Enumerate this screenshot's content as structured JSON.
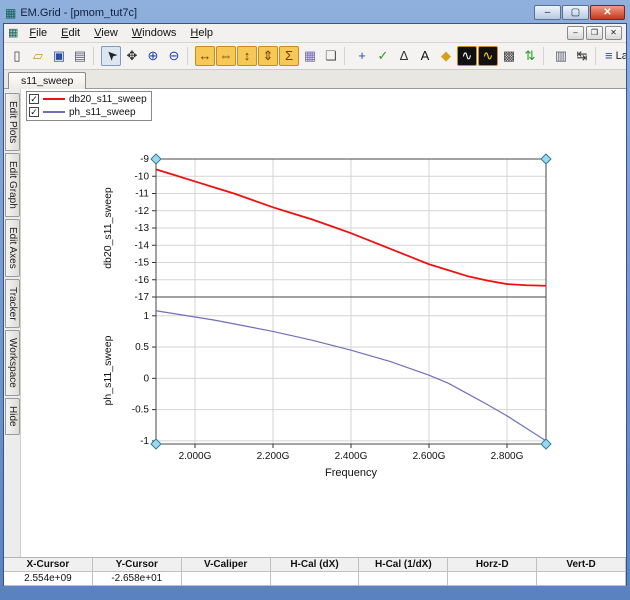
{
  "window": {
    "title": "EM.Grid - [pmom_tut7c]",
    "controls": {
      "minimize": "–",
      "maximize": "▢",
      "close": "✕"
    }
  },
  "menu": {
    "items": [
      "File",
      "Edit",
      "View",
      "Windows",
      "Help"
    ],
    "mdi_controls": {
      "minimize": "–",
      "restore": "❐",
      "close": "✕"
    }
  },
  "toolbar": {
    "icons": [
      {
        "name": "new-document",
        "glyph": "▯",
        "fg": "#444444"
      },
      {
        "name": "open-folder",
        "glyph": "▱",
        "fg": "#c8922a"
      },
      {
        "name": "save",
        "glyph": "▣",
        "fg": "#2a4fa0"
      },
      {
        "name": "print",
        "glyph": "▤",
        "fg": "#556070"
      },
      {
        "sep": true
      },
      {
        "name": "select-cursor",
        "glyph": "➤",
        "fg": "#222222",
        "rotate": -135,
        "pressed": true
      },
      {
        "name": "pan-hand",
        "glyph": "✥",
        "fg": "#333333"
      },
      {
        "name": "zoom-in",
        "glyph": "⊕",
        "fg": "#1a3fb0"
      },
      {
        "name": "zoom-out",
        "glyph": "⊖",
        "fg": "#1a3fb0"
      },
      {
        "sep": true
      },
      {
        "name": "fit-horizontal",
        "glyph": "↔",
        "fg": "#7a3c00",
        "bg": "#f6c855"
      },
      {
        "name": "shrink-horizontal",
        "glyph": "⇔",
        "fg": "#7a3c00",
        "bg": "#f6c855"
      },
      {
        "name": "fit-vertical",
        "glyph": "↕",
        "fg": "#7a3c00",
        "bg": "#f6c855"
      },
      {
        "name": "shrink-vertical",
        "glyph": "⇕",
        "fg": "#7a3c00",
        "bg": "#f6c855"
      },
      {
        "name": "autoscale",
        "glyph": "Σ",
        "fg": "#7a3c00",
        "bg": "#f6c855"
      },
      {
        "name": "grid-toggle",
        "glyph": "▦",
        "fg": "#7766bb"
      },
      {
        "name": "tile-windows",
        "glyph": "❏",
        "fg": "#555555"
      },
      {
        "sep": true
      },
      {
        "name": "add-marker",
        "glyph": "+",
        "fg": "#2a4fa0"
      },
      {
        "name": "trace-check",
        "glyph": "✓",
        "fg": "#1f9d1f"
      },
      {
        "name": "delta-measure",
        "glyph": "Δ",
        "fg": "#333333"
      },
      {
        "name": "text-annotation",
        "glyph": "A",
        "fg": "#111111"
      },
      {
        "name": "color-marker",
        "glyph": "◆",
        "fg": "#d4a017"
      },
      {
        "name": "scope-display",
        "glyph": "∿",
        "fg": "#ffffff",
        "bg": "#111111"
      },
      {
        "name": "eye-diagram",
        "glyph": "∿",
        "fg": "#ffd700",
        "bg": "#111111"
      },
      {
        "name": "persistence-grid",
        "glyph": "▩",
        "fg": "#444444"
      },
      {
        "name": "fit-trace-vertical",
        "glyph": "⇅",
        "fg": "#1f9d1f"
      },
      {
        "sep": true
      },
      {
        "name": "snapshot",
        "glyph": "▥",
        "fg": "#556070"
      },
      {
        "name": "horizontal-measure",
        "glyph": "↹",
        "fg": "#333333"
      },
      {
        "sep": true
      }
    ],
    "layout_selector": {
      "glyph": "≡",
      "label": "Layou"
    }
  },
  "tabs": [
    {
      "label": "s11_sweep",
      "active": true
    }
  ],
  "side_tabs": [
    "Edit Plots",
    "Edit Graph",
    "Edit Axes",
    "Tracker",
    "Workspace",
    "Hide"
  ],
  "legend": {
    "items": [
      {
        "label": "db20_s11_sweep",
        "color": "#ee1111",
        "checked": true
      },
      {
        "label": "ph_s11_sweep",
        "color": "#7070b8",
        "checked": true
      }
    ]
  },
  "chart_data": [
    {
      "type": "line",
      "title": "",
      "ylabel": "db20_s11_sweep",
      "xlim": [
        1.9,
        2.9
      ],
      "ylim": [
        -17,
        -9
      ],
      "yticks": [
        -9,
        -10,
        -11,
        -12,
        -13,
        -14,
        -15,
        -16,
        -17
      ],
      "grid": true,
      "legend_position": "top-left-outside",
      "series": [
        {
          "name": "db20_s11_sweep",
          "color": "#ee1111",
          "x": [
            1.9,
            1.95,
            2.0,
            2.05,
            2.1,
            2.15,
            2.2,
            2.25,
            2.3,
            2.35,
            2.4,
            2.45,
            2.5,
            2.55,
            2.6,
            2.65,
            2.7,
            2.75,
            2.8,
            2.85,
            2.9
          ],
          "values": [
            -9.6,
            -9.95,
            -10.3,
            -10.65,
            -11.0,
            -11.4,
            -11.8,
            -12.15,
            -12.5,
            -12.9,
            -13.3,
            -13.75,
            -14.2,
            -14.65,
            -15.1,
            -15.45,
            -15.8,
            -16.05,
            -16.25,
            -16.32,
            -16.35
          ]
        }
      ]
    },
    {
      "type": "line",
      "title": "",
      "ylabel": "ph_s11_sweep",
      "xlabel": "Frequency",
      "xlim": [
        1.9,
        2.9
      ],
      "ylim": [
        -1.05,
        1.3
      ],
      "yticks": [
        1,
        0.5,
        0,
        -0.5,
        -1
      ],
      "xticks": [
        2.0,
        2.2,
        2.4,
        2.6,
        2.8
      ],
      "xtick_labels": [
        "2.000G",
        "2.200G",
        "2.400G",
        "2.600G",
        "2.800G"
      ],
      "grid": true,
      "series": [
        {
          "name": "ph_s11_sweep",
          "color": "#7070b8",
          "x": [
            1.9,
            1.95,
            2.0,
            2.05,
            2.1,
            2.15,
            2.2,
            2.25,
            2.3,
            2.35,
            2.4,
            2.45,
            2.5,
            2.55,
            2.6,
            2.65,
            2.7,
            2.75,
            2.8,
            2.85,
            2.9
          ],
          "values": [
            1.08,
            1.03,
            0.98,
            0.93,
            0.87,
            0.81,
            0.75,
            0.68,
            0.61,
            0.53,
            0.45,
            0.36,
            0.27,
            0.16,
            0.05,
            -0.08,
            -0.25,
            -0.42,
            -0.6,
            -0.8,
            -1.0
          ]
        }
      ]
    }
  ],
  "cursor_table": {
    "headers": [
      "X-Cursor",
      "Y-Cursor",
      "V-Caliper",
      "H-Cal (dX)",
      "H-Cal (1/dX)",
      "Horz-D",
      "Vert-D"
    ],
    "values": [
      "2.554e+09",
      "-2.658e+01",
      "",
      "",
      "",
      "",
      ""
    ]
  },
  "colors": {
    "frame_blue": "#5a82c0",
    "toolbar_highlight": "#f6c855",
    "handle_fill": "#9fd8ec"
  }
}
